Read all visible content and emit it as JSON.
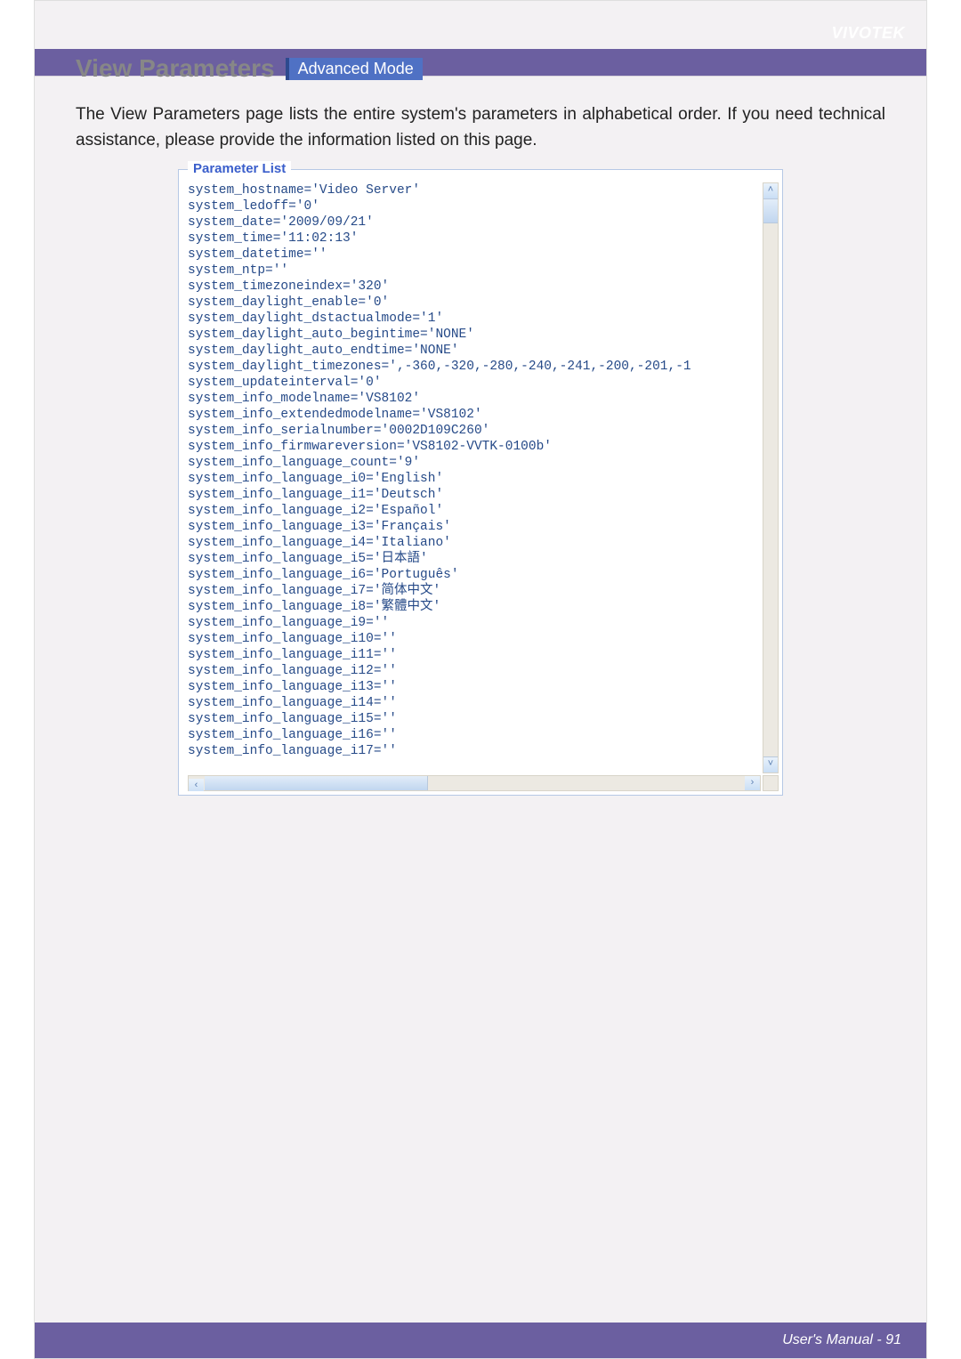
{
  "brand": "VIVOTEK",
  "page_title": "View Parameters",
  "badge": "Advanced Mode",
  "intro": "The View Parameters page lists the entire system's parameters in alphabetical order. If you need technical assistance, please provide the information listed on this page.",
  "panel": {
    "legend": "Parameter List",
    "lines": [
      "system_hostname='Video Server'",
      "system_ledoff='0'",
      "system_date='2009/09/21'",
      "system_time='11:02:13'",
      "system_datetime=''",
      "system_ntp=''",
      "system_timezoneindex='320'",
      "system_daylight_enable='0'",
      "system_daylight_dstactualmode='1'",
      "system_daylight_auto_begintime='NONE'",
      "system_daylight_auto_endtime='NONE'",
      "system_daylight_timezones=',-360,-320,-280,-240,-241,-200,-201,-1",
      "system_updateinterval='0'",
      "system_info_modelname='VS8102'",
      "system_info_extendedmodelname='VS8102'",
      "system_info_serialnumber='0002D109C260'",
      "system_info_firmwareversion='VS8102-VVTK-0100b'",
      "system_info_language_count='9'",
      "system_info_language_i0='English'",
      "system_info_language_i1='Deutsch'",
      "system_info_language_i2='Español'",
      "system_info_language_i3='Français'",
      "system_info_language_i4='Italiano'",
      "system_info_language_i5='日本語'",
      "system_info_language_i6='Português'",
      "system_info_language_i7='简体中文'",
      "system_info_language_i8='繁體中文'",
      "system_info_language_i9=''",
      "system_info_language_i10=''",
      "system_info_language_i11=''",
      "system_info_language_i12=''",
      "system_info_language_i13=''",
      "system_info_language_i14=''",
      "system_info_language_i15=''",
      "system_info_language_i16=''",
      "system_info_language_i17=''"
    ]
  },
  "footer": "User's Manual - 91"
}
